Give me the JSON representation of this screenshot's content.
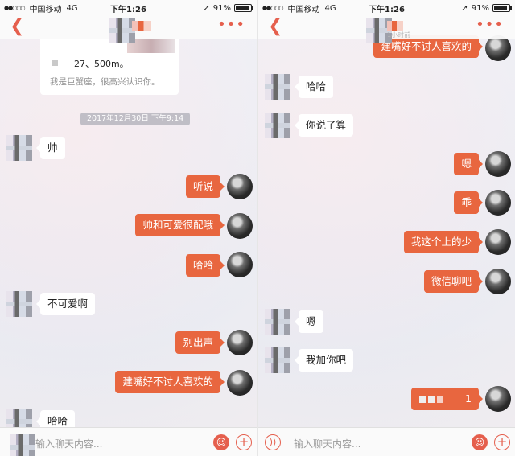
{
  "status": {
    "carrier": "中国移动",
    "network": "4G",
    "time": "下午1:26",
    "battery": "91%",
    "signal_dots": "●●○○○",
    "location_icon": "location-arrow-icon",
    "battery_level": 0.91
  },
  "nav": {
    "back_icon": "chevron-left-icon",
    "more_icon": "more-dots-icon",
    "subtitle_right": "1小时前"
  },
  "left": {
    "card": {
      "distance": "27、500m。",
      "intro": "我是巨蟹座，很高兴认识你。"
    },
    "time_divider": "2017年12月30日 下午9:14",
    "messages": [
      {
        "side": "in",
        "text": "帅"
      },
      {
        "side": "out",
        "text": "听说"
      },
      {
        "side": "out",
        "text": "帅和可爱很配哦"
      },
      {
        "side": "out",
        "text": "哈哈"
      },
      {
        "side": "in",
        "text": "不可爱啊"
      },
      {
        "side": "out",
        "text": "别出声"
      },
      {
        "side": "out",
        "text": "建嘴好不讨人喜欢的"
      },
      {
        "side": "in",
        "text": "哈哈"
      }
    ]
  },
  "right": {
    "messages": [
      {
        "side": "out",
        "text": "建嘴好不讨人喜欢的"
      },
      {
        "side": "in",
        "text": "哈哈"
      },
      {
        "side": "in",
        "text": "你说了算"
      },
      {
        "side": "out",
        "text": "嗯"
      },
      {
        "side": "out",
        "text": "乖"
      },
      {
        "side": "out",
        "text": "我这个上的少"
      },
      {
        "side": "out",
        "text": "微信聊吧"
      },
      {
        "side": "in",
        "text": "嗯"
      },
      {
        "side": "in",
        "text": "我加你吧"
      },
      {
        "side": "out",
        "text": "1"
      }
    ]
  },
  "input": {
    "placeholder": "输入聊天内容..."
  },
  "colors": {
    "accent": "#e55f4d",
    "bubble_out": "#e8663f"
  }
}
